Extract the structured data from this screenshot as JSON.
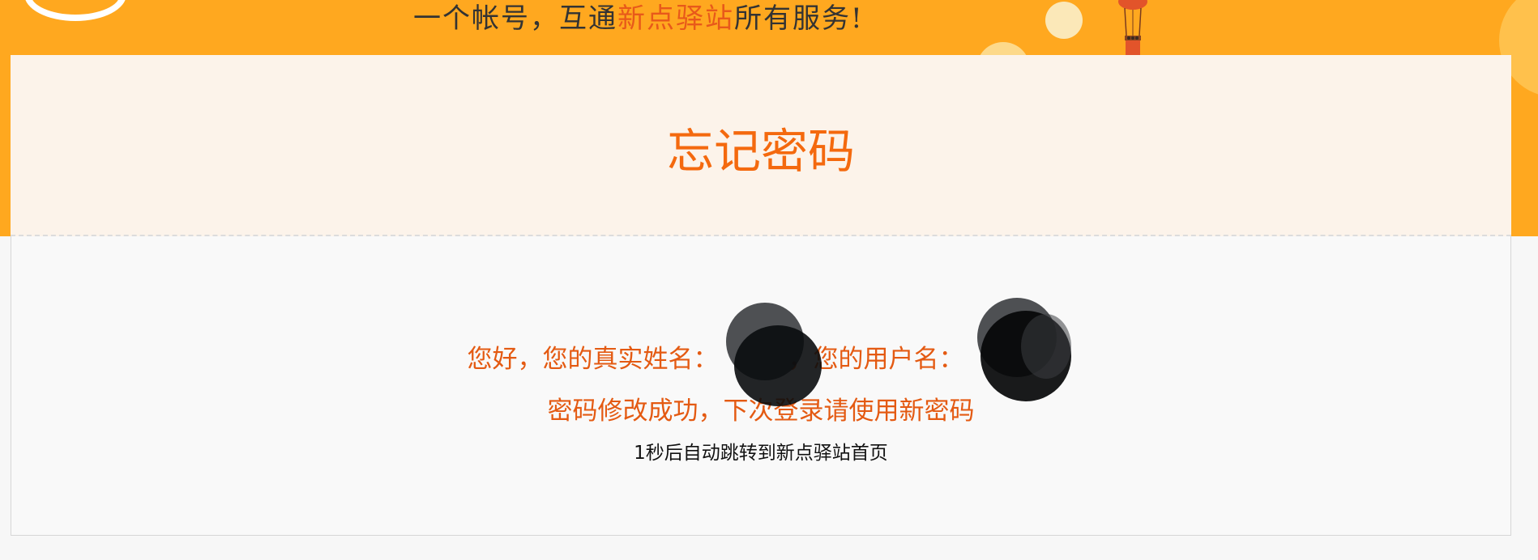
{
  "banner": {
    "slogan_pre": "一个帐号，互通",
    "slogan_brand": "新点驿站",
    "slogan_post": "所有服务!"
  },
  "card": {
    "title": "忘记密码"
  },
  "message": {
    "greeting": "您好，您的真实姓名：",
    "greeting_sep": "，您的用户名：",
    "success": "密码修改成功，下次登录请使用新密码",
    "redirect": "1秒后自动跳转到新点驿站首页"
  },
  "colors": {
    "banner_bg": "#ffa81f",
    "accent": "#f4690e",
    "card_top_bg": "#fcf3ea",
    "card_body_bg": "#f9f9f9"
  }
}
